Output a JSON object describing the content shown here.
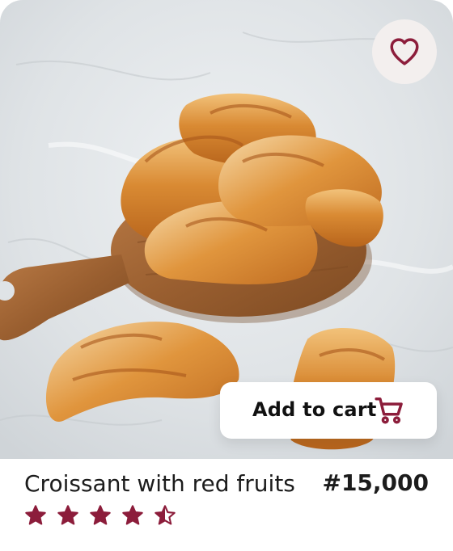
{
  "product": {
    "name": "Croissant with red fruits",
    "price": "#15,000",
    "rating": 4.5,
    "rating_max": 5
  },
  "actions": {
    "add_to_cart_label": "Add to cart"
  },
  "icons": {
    "favorite": "heart-icon",
    "cart": "cart-icon",
    "star": "star-icon"
  },
  "colors": {
    "accent": "#8c1d3b",
    "favorite_bg": "#f3efee",
    "text": "#1c1c1c"
  }
}
